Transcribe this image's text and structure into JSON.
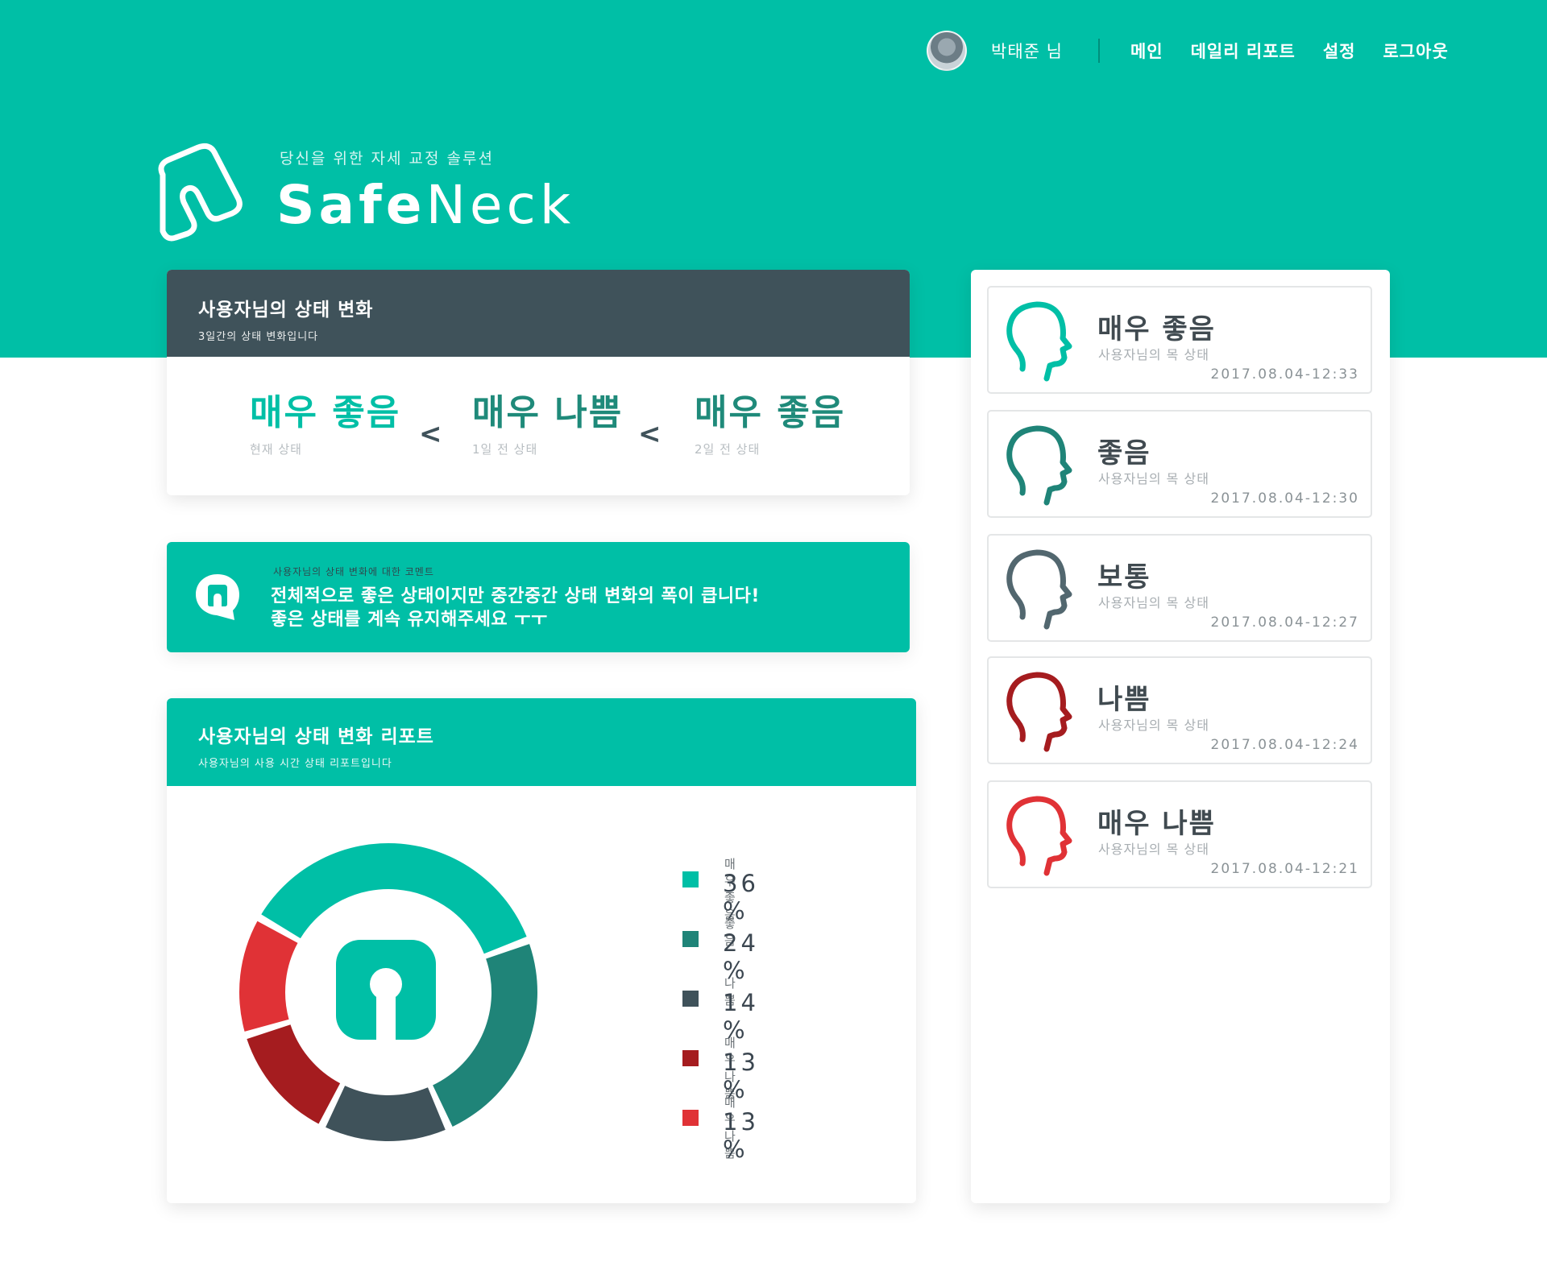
{
  "nav": {
    "user_name": "박태준 님",
    "links": [
      "메인",
      "데일리 리포트",
      "설정",
      "로그아웃"
    ]
  },
  "brand": {
    "tagline": "당신을 위한 자세 교정 솔루션",
    "name_bold": "Safe",
    "name_light": "Neck"
  },
  "status_card": {
    "title": "사용자님의 상태 변화",
    "subtitle": "3일간의 상태 변화입니다",
    "items": [
      {
        "value": "매우 좋음",
        "caption": "현재 상태",
        "color": "#00bfa6"
      },
      {
        "value": "매우 나쁨",
        "caption": "1일 전 상태",
        "color": "#1f8a7a"
      },
      {
        "value": "매우 좋음",
        "caption": "2일 전 상태",
        "color": "#1f8a7a"
      }
    ],
    "separator": "<"
  },
  "comment": {
    "subtitle": "사용자님의 상태 변화에 대한 코멘트",
    "line1": "전체적으로 좋은 상태이지만 중간중간 상태 변화의 폭이 큽니다!",
    "line2": "좋은 상태를 계속 유지해주세요 ㅜㅜ"
  },
  "report": {
    "title": "사용자님의 상태 변화 리포트",
    "subtitle": "사용자님의 사용 시간 상태 리포트입니다"
  },
  "chart_data": {
    "type": "pie",
    "categories": [
      "매우 좋음",
      "좋음",
      "나쁨",
      "매우 나쁨",
      "매우 나쁨"
    ],
    "values": [
      36,
      24,
      14,
      13,
      13
    ],
    "value_labels": [
      "36 %",
      "24 %",
      "14 %",
      "13 %",
      "13 %"
    ],
    "colors": [
      "#00bfa6",
      "#1f8478",
      "#3f525a",
      "#a51c1f",
      "#e03236"
    ],
    "style": "donut"
  },
  "history": {
    "subtitle": "사용자님의 목 상태",
    "items": [
      {
        "title": "매우 좋음",
        "time": "2017.08.04-12:33",
        "color": "#00bfa6"
      },
      {
        "title": "좋음",
        "time": "2017.08.04-12:30",
        "color": "#1f8478"
      },
      {
        "title": "보통",
        "time": "2017.08.04-12:27",
        "color": "#52676f"
      },
      {
        "title": "나쁨",
        "time": "2017.08.04-12:24",
        "color": "#a51c1f"
      },
      {
        "title": "매우 나쁨",
        "time": "2017.08.04-12:21",
        "color": "#e03236"
      }
    ]
  }
}
